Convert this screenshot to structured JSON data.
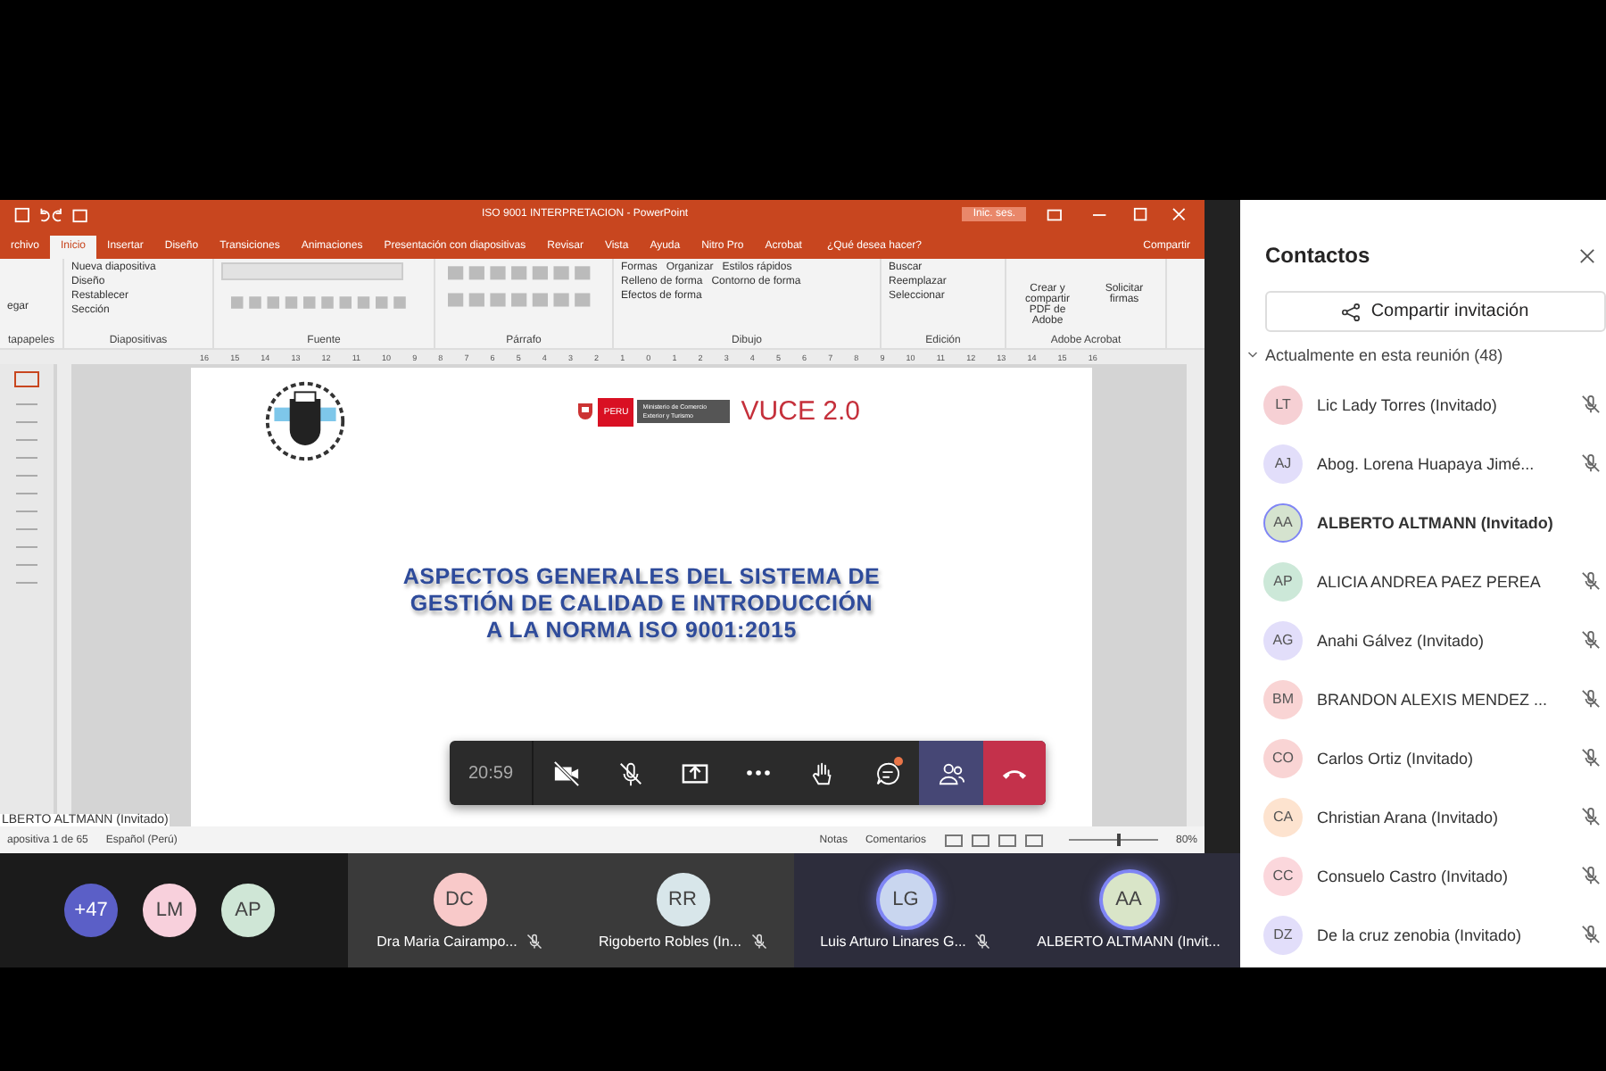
{
  "ppt": {
    "title": "ISO 9001 INTERPRETACION - PowerPoint",
    "signin": "Inic. ses.",
    "tabs": [
      {
        "label": "rchivo",
        "selected": false
      },
      {
        "label": "Inicio",
        "selected": true
      },
      {
        "label": "Insertar",
        "selected": false
      },
      {
        "label": "Diseño",
        "selected": false
      },
      {
        "label": "Transiciones",
        "selected": false
      },
      {
        "label": "Animaciones",
        "selected": false
      },
      {
        "label": "Presentación con diapositivas",
        "selected": false
      },
      {
        "label": "Revisar",
        "selected": false
      },
      {
        "label": "Vista",
        "selected": false
      },
      {
        "label": "Ayuda",
        "selected": false
      },
      {
        "label": "Nitro Pro",
        "selected": false
      },
      {
        "label": "Acrobat",
        "selected": false
      }
    ],
    "tell_me": "¿Qué desea hacer?",
    "share": "Compartir",
    "groups": [
      {
        "label": "tapapeles",
        "kind": "clipboard",
        "items": [
          "egar"
        ]
      },
      {
        "label": "Diapositivas",
        "kind": "slides",
        "items": [
          "Nueva diapositiva",
          "Diseño",
          "Restablecer",
          "Sección"
        ]
      },
      {
        "label": "Fuente",
        "kind": "font"
      },
      {
        "label": "Párrafo",
        "kind": "paragraph"
      },
      {
        "label": "Dibujo",
        "kind": "drawing",
        "items": [
          "Formas",
          "Organizar",
          "Estilos rápidos",
          "Relleno de forma",
          "Contorno de forma",
          "Efectos de forma"
        ]
      },
      {
        "label": "Edición",
        "kind": "editing",
        "items": [
          "Buscar",
          "Reemplazar",
          "Seleccionar"
        ]
      },
      {
        "label": "Adobe Acrobat",
        "kind": "acrobat",
        "items": [
          "Crear y compartir PDF de Adobe",
          "Solicitar firmas"
        ]
      }
    ],
    "ruler": [
      "16",
      "15",
      "14",
      "13",
      "12",
      "11",
      "10",
      "9",
      "8",
      "7",
      "6",
      "5",
      "4",
      "3",
      "2",
      "1",
      "0",
      "1",
      "2",
      "3",
      "4",
      "5",
      "6",
      "7",
      "8",
      "9",
      "10",
      "11",
      "12",
      "13",
      "14",
      "15",
      "16"
    ],
    "slide": {
      "peru": "PERU",
      "ministry": "Ministerio de Comercio Exterior y Turismo",
      "brand": "VUCE 2.0",
      "title": [
        "ASPECTOS GENERALES DEL SISTEMA DE",
        "GESTIÓN DE CALIDAD E INTRODUCCIÓN",
        "A LA NORMA ISO 9001:2015"
      ]
    },
    "presenter": "LBERTO ALTMANN (Invitado)",
    "status": {
      "slide": "apositiva 1 de 65",
      "language": "Español (Perú)",
      "notes": "Notas",
      "comments": "Comentarios",
      "zoom": "80%",
      "level": 0.55
    }
  },
  "call_bar": {
    "time": "20:59",
    "buttons": [
      {
        "kind": "camera-off",
        "selected": false,
        "unread": false
      },
      {
        "kind": "mic-off",
        "selected": false,
        "unread": false
      },
      {
        "kind": "share",
        "selected": false,
        "unread": false
      },
      {
        "kind": "more",
        "selected": false,
        "unread": false
      },
      {
        "kind": "hand",
        "selected": false,
        "unread": false
      },
      {
        "kind": "chat",
        "selected": false,
        "unread": true
      },
      {
        "kind": "people",
        "selected": true,
        "unread": false
      },
      {
        "kind": "hangup",
        "selected": false,
        "unread": false
      }
    ]
  },
  "strip": {
    "overflow": "+47",
    "avatars": [
      {
        "initials": "LM",
        "color": "#f8d0dc"
      },
      {
        "initials": "AP",
        "color": "#cfe6d6"
      }
    ],
    "tiles": [
      {
        "initials": "DC",
        "name": "Dra Maria Cairampo...",
        "color": "#f8c9c9",
        "muted": true,
        "speaking": false
      },
      {
        "initials": "RR",
        "name": "Rigoberto Robles (In...",
        "color": "#d8e6ea",
        "muted": true,
        "speaking": false
      },
      {
        "initials": "LG",
        "name": "Luis Arturo Linares G...",
        "color": "#c9d6ef",
        "muted": true,
        "speaking": true
      },
      {
        "initials": "AA",
        "name": "ALBERTO ALTMANN (Invit...",
        "color": "#d9e5c8",
        "muted": false,
        "speaking": true
      }
    ]
  },
  "panel": {
    "title": "Contactos",
    "invite": "Compartir invitación",
    "section": "Actualmente en esta reunión (48)",
    "expanded": true,
    "people": [
      {
        "initials": "LT",
        "name": "Lic Lady Torres (Invitado)",
        "color": "#f6d0d4",
        "muted": true,
        "self": false
      },
      {
        "initials": "AJ",
        "name": "Abog. Lorena Huapaya Jimé...",
        "color": "#e2defa",
        "muted": true,
        "self": false
      },
      {
        "initials": "AA",
        "name": "ALBERTO ALTMANN (Invitado)",
        "color": "#d5e3cf",
        "muted": false,
        "self": true
      },
      {
        "initials": "AP",
        "name": "ALICIA ANDREA PAEZ PEREA",
        "color": "#cce8d8",
        "muted": true,
        "self": false
      },
      {
        "initials": "AG",
        "name": "Anahi Gálvez (Invitado)",
        "color": "#e2defa",
        "muted": true,
        "self": false
      },
      {
        "initials": "BM",
        "name": "BRANDON ALEXIS MENDEZ ...",
        "color": "#f9d4d4",
        "muted": true,
        "self": false
      },
      {
        "initials": "CO",
        "name": "Carlos Ortiz (Invitado)",
        "color": "#f9d4d4",
        "muted": true,
        "self": false
      },
      {
        "initials": "CA",
        "name": "Christian Arana (Invitado)",
        "color": "#fde3cf",
        "muted": true,
        "self": false
      },
      {
        "initials": "CC",
        "name": "Consuelo Castro (Invitado)",
        "color": "#fbd7dc",
        "muted": true,
        "self": false
      },
      {
        "initials": "DZ",
        "name": "De la cruz zenobia (Invitado)",
        "color": "#e2defa",
        "muted": true,
        "self": false
      }
    ]
  }
}
